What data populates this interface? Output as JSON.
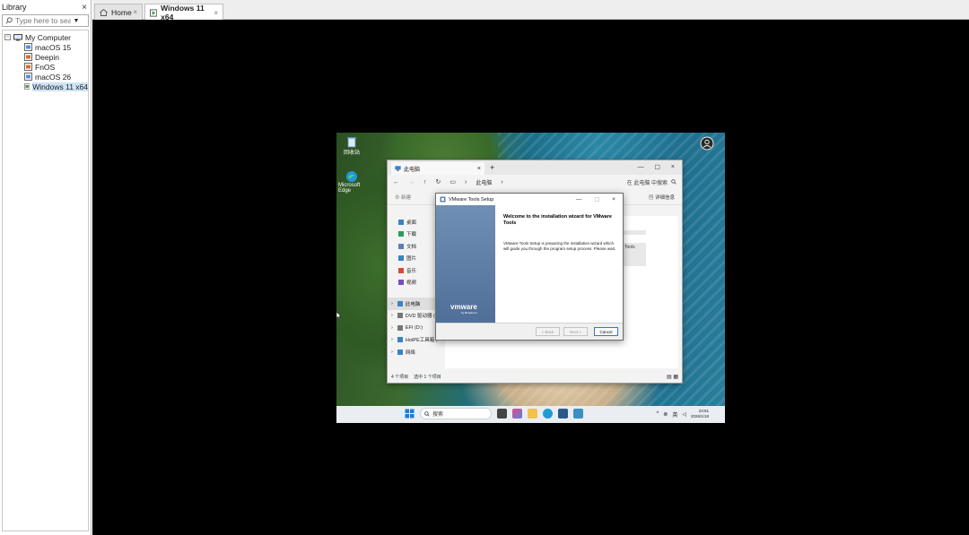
{
  "library": {
    "title": "Library",
    "close": "×",
    "search_placeholder": "Type here to sea...",
    "tree": {
      "root": "My Computer",
      "vms": [
        {
          "name": "macOS 15",
          "color": "#5b8bd9"
        },
        {
          "name": "Deepin",
          "color": "#d96b27"
        },
        {
          "name": "FnOS",
          "color": "#d96b27"
        },
        {
          "name": "macOS 26",
          "color": "#5b8bd9"
        },
        {
          "name": "Windows 11 x64",
          "color": "#3c9a3c"
        }
      ]
    }
  },
  "tabs": {
    "home": "Home",
    "active": "Windows 11 x64",
    "close": "×"
  },
  "guest": {
    "desktop": {
      "recycle_label": "回收站",
      "edge_label": "Microsoft Edge"
    },
    "explorer": {
      "tab_title": "此电脑",
      "close": "×",
      "new_tab": "+",
      "min": "—",
      "max": "☐",
      "crumb": "此电脑",
      "search_text": "在 此电脑 中搜索",
      "new_button": "新建",
      "details_button": "详细信息",
      "nav_items": [
        {
          "label": "桌面",
          "color": "#3b82c4"
        },
        {
          "label": "下载",
          "color": "#2a9d5c"
        },
        {
          "label": "文档",
          "color": "#5a7fb5"
        },
        {
          "label": "图片",
          "color": "#3b82c4"
        },
        {
          "label": "音乐",
          "color": "#d9483b"
        },
        {
          "label": "视频",
          "color": "#7a4fc1"
        }
      ],
      "drive_items": [
        {
          "label": "此电脑",
          "color": "#3b82c4",
          "selected": true
        },
        {
          "label": "DVD 驱动器 (",
          "color": "#777777",
          "selected": false
        },
        {
          "label": "EFI (D:)",
          "color": "#777777",
          "selected": false
        },
        {
          "label": "HotPE工具箱 (",
          "color": "#3b82c4",
          "selected": false
        },
        {
          "label": "网络",
          "color": "#3b82c4",
          "selected": false
        }
      ],
      "content_fragment": "Tools",
      "status_items": "4 个项目",
      "status_selected": "选中 1 个项目"
    },
    "setup": {
      "title": "VMware Tools Setup",
      "heading": "Welcome to the installation wizard for VMware Tools",
      "description": "VMware Tools Setup is preparing the installation wizard which will guide you through the program setup process.  Please wait.",
      "logo": "vmware",
      "logo_sub": "by Broadcom",
      "back_label": "< Back",
      "next_label": "Next >",
      "cancel_label": "Cancel",
      "close": "×",
      "min": "—",
      "max": "☐"
    },
    "taskbar": {
      "search_label": "搜索",
      "ime_label": "英",
      "time": "23:51",
      "date": "2026/1/18"
    }
  }
}
